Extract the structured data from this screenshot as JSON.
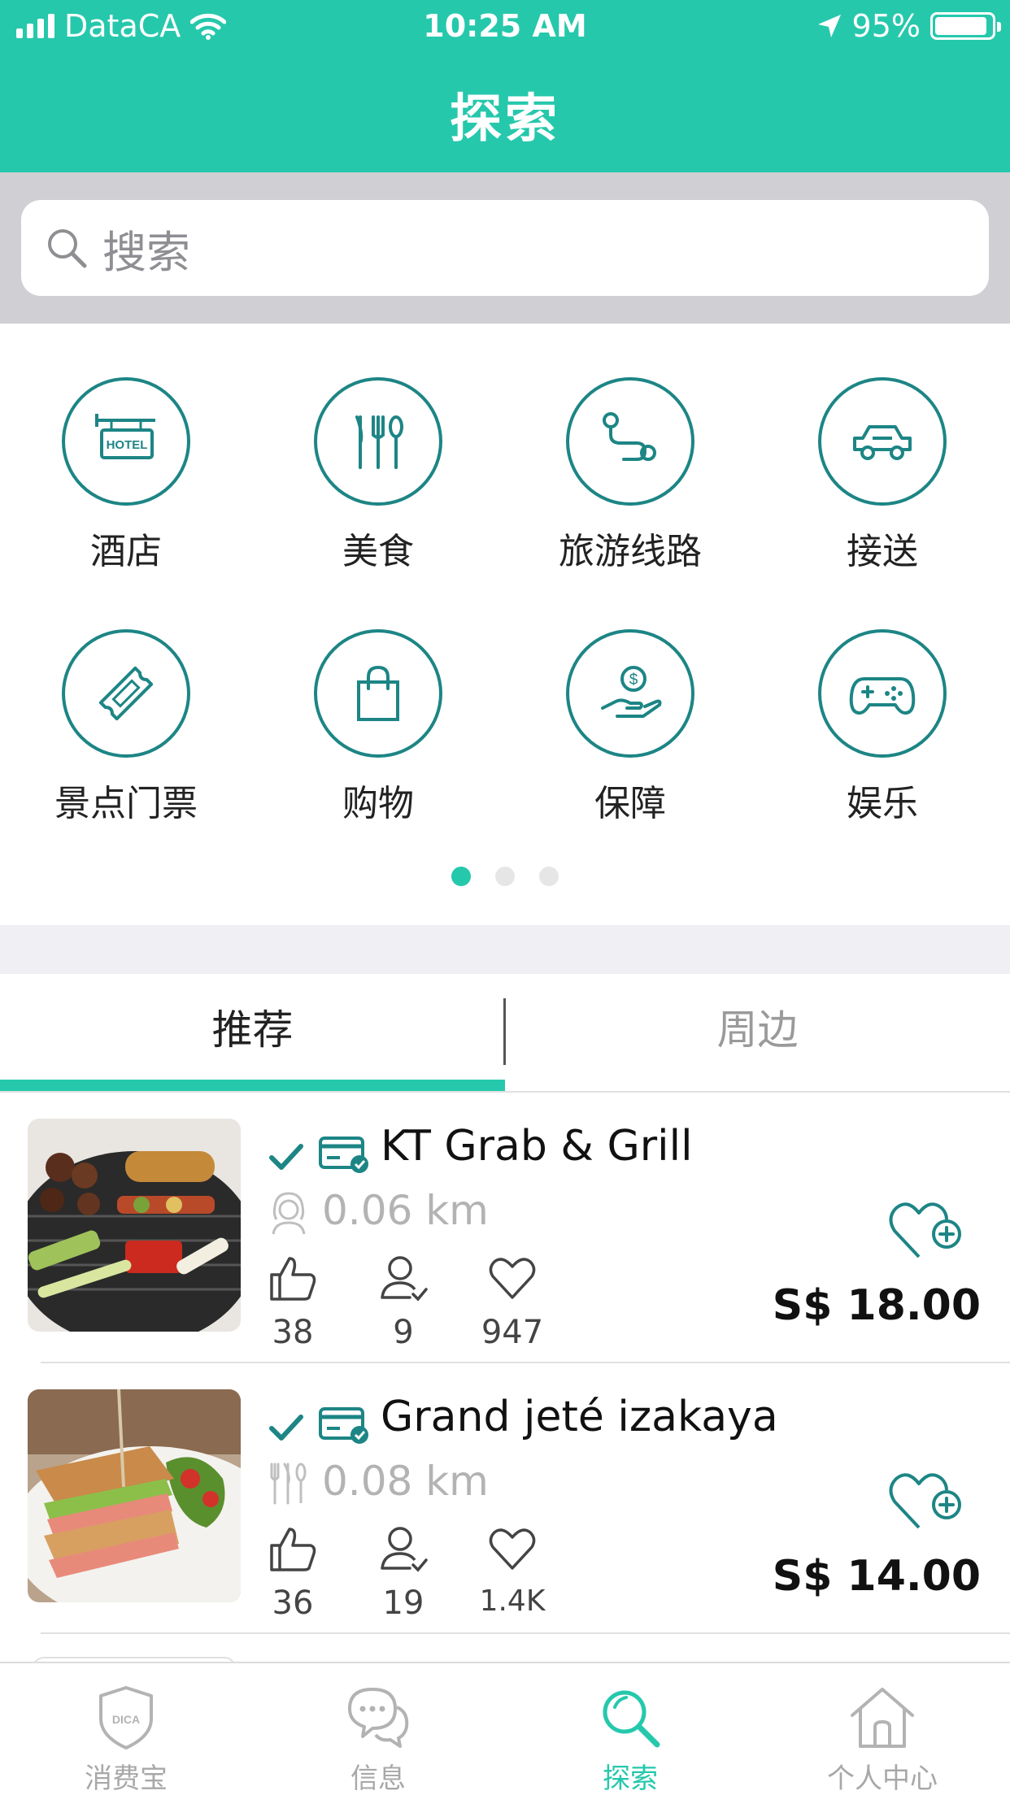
{
  "status_bar": {
    "carrier": "DataCA",
    "time": "10:25 AM",
    "battery": "95%"
  },
  "header": {
    "title": "探索"
  },
  "search": {
    "placeholder": "搜索"
  },
  "categories": [
    {
      "label": "酒店",
      "icon": "hotel-sign-icon"
    },
    {
      "label": "美食",
      "icon": "cutlery-icon"
    },
    {
      "label": "旅游线路",
      "icon": "route-icon"
    },
    {
      "label": "接送",
      "icon": "car-icon"
    },
    {
      "label": "景点门票",
      "icon": "ticket-icon"
    },
    {
      "label": "购物",
      "icon": "shopping-bag-icon"
    },
    {
      "label": "保障",
      "icon": "insurance-hand-coin-icon"
    },
    {
      "label": "娱乐",
      "icon": "gamepad-icon"
    }
  ],
  "hotel_sign_text": "HOTEL",
  "pager": {
    "pages": 3,
    "active": 1
  },
  "tabs": [
    {
      "label": "推荐",
      "active": true
    },
    {
      "label": "周边",
      "active": false
    }
  ],
  "listings": [
    {
      "name": "KT Grab & Grill",
      "distance": "0.06 km",
      "type_icon": "person-icon",
      "likes": "38",
      "visits": "9",
      "favorites": "947",
      "price": "S$  18.00"
    },
    {
      "name": "Grand jeté izakaya",
      "distance": "0.08 km",
      "type_icon": "cutlery-icon",
      "likes": "36",
      "visits": "19",
      "favorites": "1.4K",
      "price": "S$ 14.00"
    }
  ],
  "bottom_nav": [
    {
      "label": "消费宝",
      "icon": "dica-shield-icon",
      "badge_text": "DICA",
      "active": false
    },
    {
      "label": "信息",
      "icon": "chat-bubbles-icon",
      "active": false
    },
    {
      "label": "探索",
      "icon": "search-icon",
      "active": true
    },
    {
      "label": "个人中心",
      "icon": "home-icon",
      "active": false
    }
  ],
  "colors": {
    "brand": "#26c8ac",
    "icon_teal": "#1d8585",
    "muted": "#b3b3b3"
  }
}
